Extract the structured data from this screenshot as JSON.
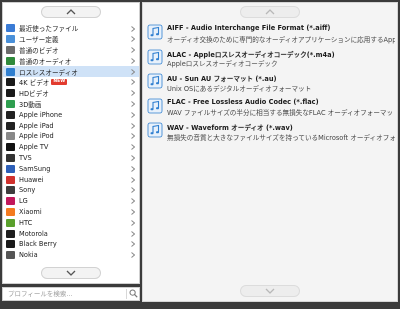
{
  "categories": [
    {
      "label": "最近使ったファイル",
      "icon": "clock-icon",
      "color": "#3a7bd5",
      "new": false,
      "selected": false
    },
    {
      "label": "ユーザー定義",
      "icon": "user-icon",
      "color": "#4a90d9",
      "new": false,
      "selected": false
    },
    {
      "label": "普通のビデオ",
      "icon": "video-icon",
      "color": "#6b6b6b",
      "new": false,
      "selected": false
    },
    {
      "label": "普通のオーディオ",
      "icon": "audio-icon",
      "color": "#2f8a3c",
      "new": false,
      "selected": false
    },
    {
      "label": "ロスレスオーディオ",
      "icon": "music-note-icon",
      "color": "#2f7fd0",
      "new": false,
      "selected": true
    },
    {
      "label": "4K ビデオ",
      "icon": "4k-icon",
      "color": "#1a1a1a",
      "new": true,
      "new_label": "NEW",
      "selected": false
    },
    {
      "label": "HDビデオ",
      "icon": "hd-icon",
      "color": "#1a1a1a",
      "new": false,
      "selected": false
    },
    {
      "label": "3D動画",
      "icon": "3d-icon",
      "color": "#2e9e4f",
      "new": false,
      "selected": false
    },
    {
      "label": "Apple iPhone",
      "icon": "iphone-icon",
      "color": "#222222",
      "new": false,
      "selected": false
    },
    {
      "label": "Apple iPad",
      "icon": "ipad-icon",
      "color": "#222222",
      "new": false,
      "selected": false
    },
    {
      "label": "Apple iPod",
      "icon": "ipod-icon",
      "color": "#888888",
      "new": false,
      "selected": false
    },
    {
      "label": "Apple TV",
      "icon": "apple-tv-icon",
      "color": "#111111",
      "new": false,
      "selected": false
    },
    {
      "label": "TVS",
      "icon": "tv-icon",
      "color": "#333333",
      "new": false,
      "selected": false
    },
    {
      "label": "SamSung",
      "icon": "samsung-icon",
      "color": "#2d5fb8",
      "new": false,
      "selected": false
    },
    {
      "label": "Huawei",
      "icon": "huawei-icon",
      "color": "#d0312d",
      "new": false,
      "selected": false
    },
    {
      "label": "Sony",
      "icon": "sony-icon",
      "color": "#3d3d3d",
      "new": false,
      "selected": false
    },
    {
      "label": "LG",
      "icon": "lg-icon",
      "color": "#c2185b",
      "new": false,
      "selected": false
    },
    {
      "label": "Xiaomi",
      "icon": "xiaomi-icon",
      "color": "#f47b20",
      "new": false,
      "selected": false
    },
    {
      "label": "HTC",
      "icon": "htc-icon",
      "color": "#5aa02c",
      "new": false,
      "selected": false
    },
    {
      "label": "Motorola",
      "icon": "motorola-icon",
      "color": "#1f1f1f",
      "new": false,
      "selected": false
    },
    {
      "label": "Black Berry",
      "icon": "blackberry-icon",
      "color": "#1a1a1a",
      "new": false,
      "selected": false
    },
    {
      "label": "Nokia",
      "icon": "nokia-icon",
      "color": "#555555",
      "new": false,
      "selected": false
    }
  ],
  "search": {
    "placeholder": "プロフィールを検索..."
  },
  "formats": [
    {
      "title": "AIFF - Audio Interchange File Format (*.aiff)",
      "desc": "オーディオ交換のために専門的なオーディオアプリケーションに応用するApple Macintosh..."
    },
    {
      "title": "ALAC - Appleロスレスオーディオコーデック(*.m4a)",
      "desc": "Appleロスレスオーディオコーデック"
    },
    {
      "title": "AU - Sun AU フォーマット (*.au)",
      "desc": "Unix OSにあるデジタルオーディオフォーマット"
    },
    {
      "title": "FLAC - Free Lossless Audio Codec (*.flac)",
      "desc": "WAV ファイルサイズの半分に相当する無損失なFLAC オーディオフォーマット"
    },
    {
      "title": "WAV - Waveform オーディオ (*.wav)",
      "desc": "無損失の音質と大きなファイルサイズを持っているMicrosoft オーディオフォーマット"
    }
  ]
}
